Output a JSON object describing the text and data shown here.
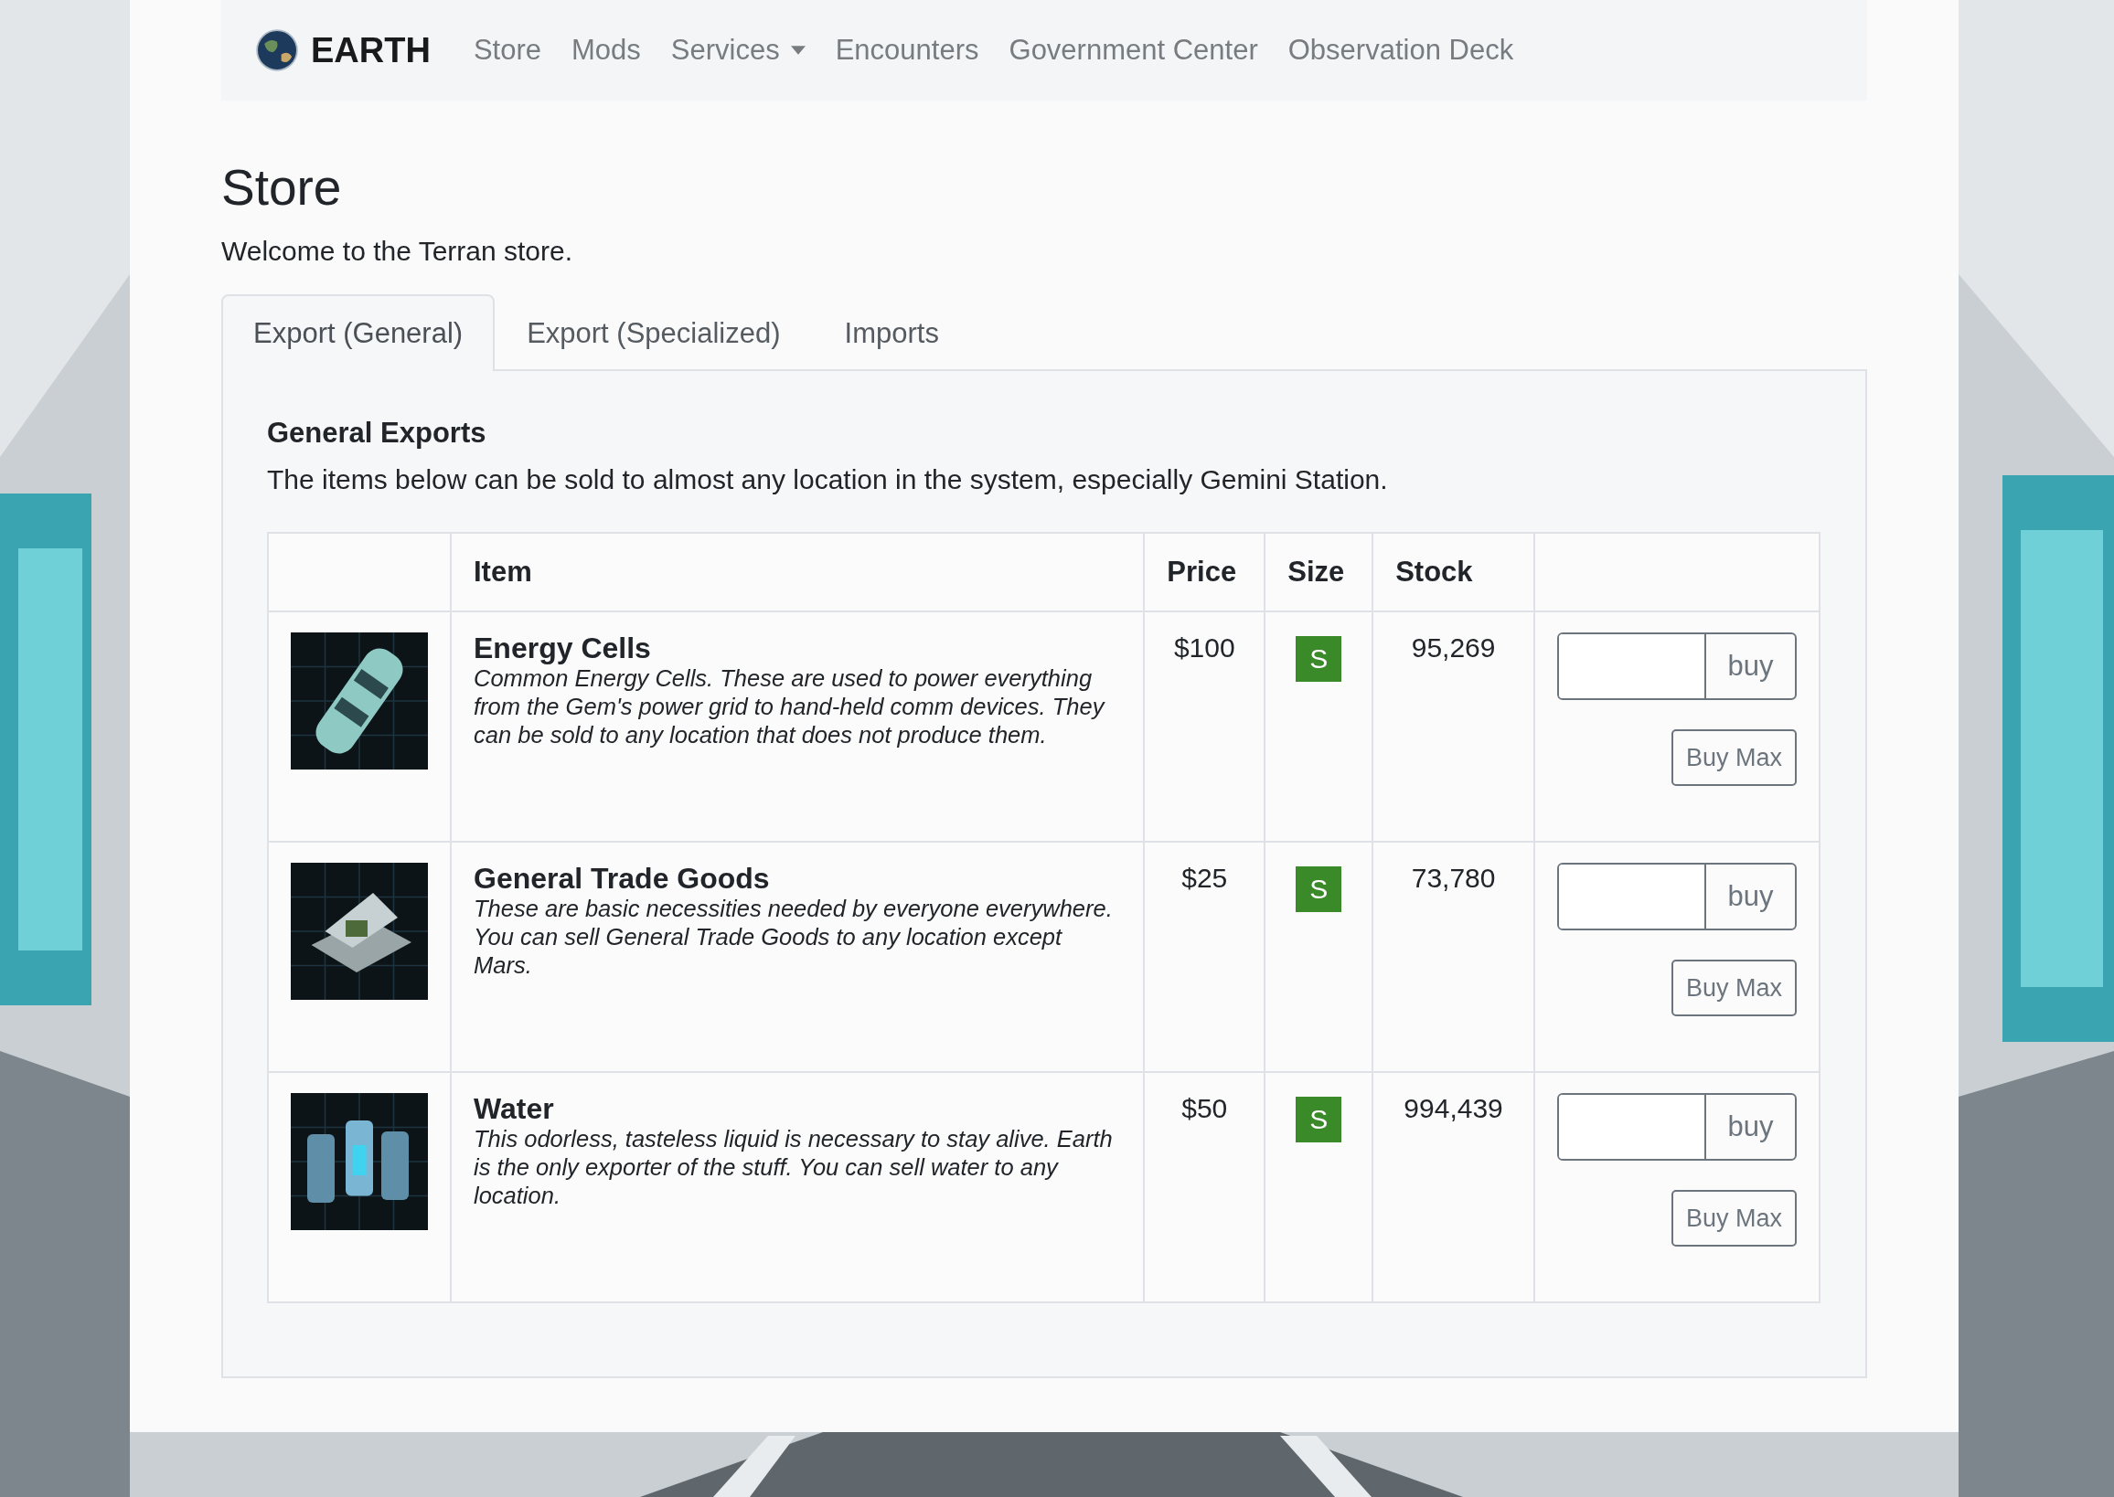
{
  "navbar": {
    "brand": "EARTH",
    "links": [
      {
        "label": "Store",
        "kind": "link"
      },
      {
        "label": "Mods",
        "kind": "link"
      },
      {
        "label": "Services",
        "kind": "dropdown"
      },
      {
        "label": "Encounters",
        "kind": "link"
      },
      {
        "label": "Government Center",
        "kind": "link"
      },
      {
        "label": "Observation Deck",
        "kind": "link"
      }
    ]
  },
  "page": {
    "title": "Store",
    "intro": "Welcome to the Terran store."
  },
  "tabs": [
    {
      "label": "Export (General)",
      "selected": true
    },
    {
      "label": "Export (Specialized)",
      "selected": false
    },
    {
      "label": "Imports",
      "selected": false
    }
  ],
  "panel": {
    "title": "General Exports",
    "description": "The items below can be sold to almost any location in the system, especially Gemini Station."
  },
  "table": {
    "columns": {
      "item": "Item",
      "price": "Price",
      "size": "Size",
      "stock": "Stock"
    },
    "rows": [
      {
        "name": "Energy Cells",
        "description": "Common Energy Cells. These are used to power everything from the Gem's power grid to hand-held comm devices. They can be sold to any location that does not produce them.",
        "price": "$100",
        "size": "S",
        "stock": "95,269",
        "buy": "buy",
        "buy_max": "Buy Max"
      },
      {
        "name": "General Trade Goods",
        "description": "These are basic necessities needed by everyone everywhere. You can sell General Trade Goods to any location except Mars.",
        "price": "$25",
        "size": "S",
        "stock": "73,780",
        "buy": "buy",
        "buy_max": "Buy Max"
      },
      {
        "name": "Water",
        "description": "This odorless, tasteless liquid is necessary to stay alive. Earth is the only exporter of the stuff. You can sell water to any location.",
        "price": "$50",
        "size": "S",
        "stock": "994,439",
        "buy": "buy",
        "buy_max": "Buy Max"
      }
    ]
  }
}
